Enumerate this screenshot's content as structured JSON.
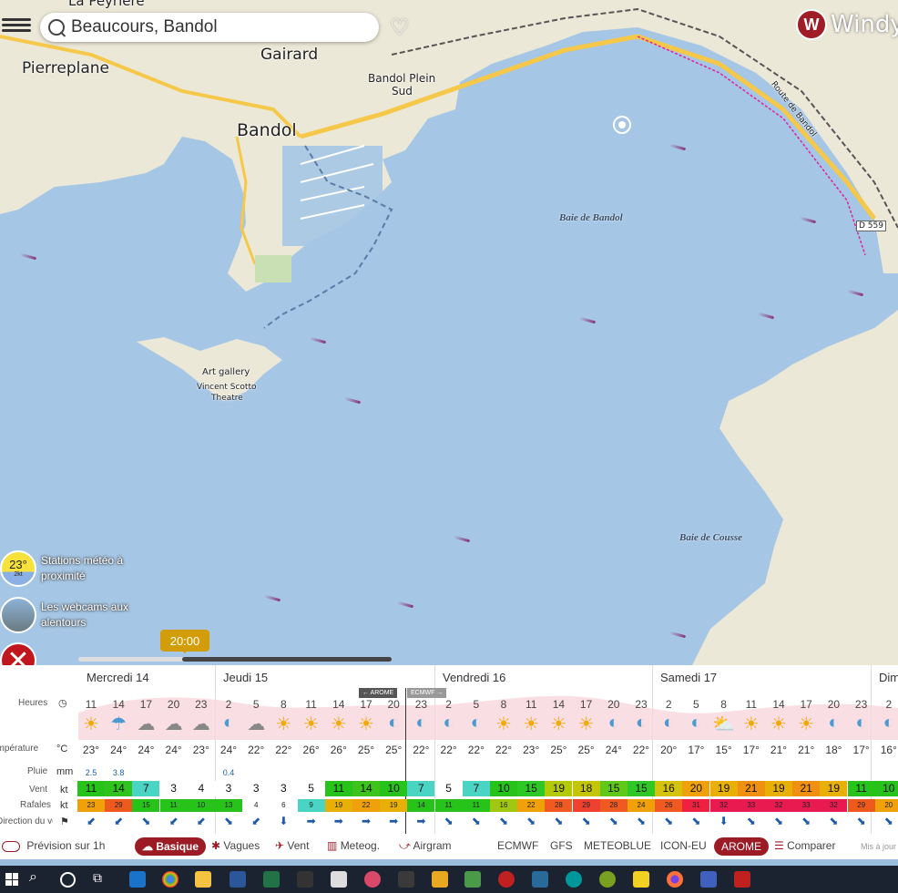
{
  "search": {
    "value": "Beaucours, Bandol",
    "placeholder": ""
  },
  "logo": {
    "text": "Windy"
  },
  "map": {
    "places": [
      {
        "name": "Pierreplane",
        "size": 17
      },
      {
        "name": "Gairard",
        "size": 17
      },
      {
        "name": "Bandol",
        "size": 19
      },
      {
        "name": "Bandol Plein",
        "size": 12
      },
      {
        "name": "Sud",
        "size": 12
      },
      {
        "name": "Art gallery",
        "size": 10
      },
      {
        "name": "Vincent Scotto",
        "size": 9
      },
      {
        "name": "Theatre",
        "size": 9
      },
      {
        "name": "Route de Bandol",
        "size": 9
      },
      {
        "name": "D 559",
        "size": 9
      },
      {
        "name": "La Peyrière",
        "size": 15
      }
    ],
    "sea_labels": [
      "Baie de Bandol",
      "Baie de Cousse"
    ]
  },
  "widgets": {
    "stations": {
      "temp": "23°",
      "wind": "2kt",
      "label_line1": "Stations météo à",
      "label_line2": "proximité"
    },
    "webcams": {
      "label_line1": "Les webcams aux",
      "label_line2": "alentours"
    }
  },
  "timeline": {
    "time": "20:00",
    "progress": 0.33
  },
  "forecast": {
    "days": [
      "Mercredi 14",
      "Jeudi 15",
      "Vendredi 16",
      "Samedi 17",
      "Dim"
    ],
    "row_labels": {
      "hours": "Heures",
      "temp": "Température",
      "temp_unit": "°C",
      "rain": "Pluie",
      "rain_unit": "mm",
      "wind": "Vent",
      "wind_unit": "kt",
      "gusts": "Rafales",
      "gusts_unit": "kt",
      "dir": "Direction du vent"
    },
    "model_tags": {
      "left": "← AROME",
      "right": "ECMWF →"
    },
    "hours": [
      "11",
      "14",
      "17",
      "20",
      "23",
      "2",
      "5",
      "8",
      "11",
      "14",
      "17",
      "20",
      "23",
      "2",
      "5",
      "8",
      "11",
      "14",
      "17",
      "20",
      "23",
      "2",
      "5",
      "8",
      "11",
      "14",
      "17",
      "20",
      "23",
      "2"
    ],
    "icons": [
      "sun-rain",
      "rain",
      "cloud",
      "moon-cloud",
      "moon-cloud",
      "moon",
      "moon-cloud",
      "sun",
      "sun",
      "sun",
      "sun",
      "moon",
      "moon",
      "moon",
      "moon",
      "sun",
      "sun",
      "sun",
      "sun",
      "moon",
      "moon",
      "moon",
      "moon",
      "sun-cloud",
      "sun",
      "sun",
      "sun",
      "moon",
      "moon",
      "moon"
    ],
    "temps": [
      "23°",
      "24°",
      "24°",
      "24°",
      "23°",
      "24°",
      "22°",
      "22°",
      "26°",
      "26°",
      "25°",
      "25°",
      "22°",
      "22°",
      "22°",
      "22°",
      "23°",
      "25°",
      "25°",
      "24°",
      "22°",
      "20°",
      "17°",
      "15°",
      "17°",
      "21°",
      "21°",
      "18°",
      "17°",
      "16°"
    ],
    "rain": [
      "2.5",
      "3.8",
      "",
      "",
      "",
      "0.4",
      "",
      "",
      "",
      "",
      "",
      "",
      "",
      "",
      "",
      "",
      "",
      "",
      "",
      "",
      "",
      "",
      "",
      "",
      "",
      "",
      "",
      "",
      "",
      ""
    ],
    "wind": [
      "11",
      "14",
      "7",
      "3",
      "4",
      "3",
      "3",
      "3",
      "5",
      "11",
      "14",
      "10",
      "7",
      "5",
      "7",
      "10",
      "15",
      "19",
      "18",
      "15",
      "15",
      "16",
      "20",
      "19",
      "21",
      "19",
      "21",
      "19",
      "11",
      "10"
    ],
    "gusts": [
      "23",
      "29",
      "15",
      "11",
      "10",
      "13",
      "4",
      "6",
      "9",
      "19",
      "22",
      "19",
      "14",
      "11",
      "11",
      "16",
      "22",
      "28",
      "29",
      "28",
      "24",
      "26",
      "31",
      "32",
      "33",
      "32",
      "33",
      "32",
      "29",
      "20"
    ],
    "wind_colors": [
      "#27c21a",
      "#30c21d",
      "#4ad4c3",
      "#ffffff",
      "#ffffff",
      "#ffffff",
      "#ffffff",
      "#ffffff",
      "#ffffff",
      "#27c21a",
      "#3ec21c",
      "#27c21a",
      "#4ad4c3",
      "#ffffff",
      "#4ad4c3",
      "#27c21a",
      "#2ec826",
      "#b3c807",
      "#c4c605",
      "#5fc81a",
      "#2ec826",
      "#d4c20c",
      "#f0a008",
      "#e8b007",
      "#f09010",
      "#e8b007",
      "#f09010",
      "#e8b007",
      "#27c21a",
      "#27c21a"
    ],
    "gust_colors": [
      "#f0a008",
      "#ee5a1d",
      "#27c21a",
      "#27c21a",
      "#27c21a",
      "#27c21a",
      "#ffffff",
      "#ffffff",
      "#4ad4c3",
      "#e8b007",
      "#f0a008",
      "#e8b007",
      "#27c21a",
      "#27c21a",
      "#27c21a",
      "#a0c810",
      "#f0a008",
      "#f05a22",
      "#f04030",
      "#f05a22",
      "#f0a008",
      "#f05a22",
      "#f02040",
      "#e81a50",
      "#e81a50",
      "#e81a50",
      "#e81a50",
      "#e81a50",
      "#ee5a1d",
      "#f0a008"
    ],
    "dirs": [
      "⬋",
      "⬋",
      "⬊",
      "⬋",
      "⬋",
      "⬊",
      "⬋",
      "⬇",
      "➡",
      "➡",
      "➡",
      "➡",
      "➡",
      "⬊",
      "⬊",
      "⬊",
      "⬊",
      "⬊",
      "⬊",
      "⬊",
      "⬊",
      "⬊",
      "⬊",
      "⬇",
      "⬊",
      "⬊",
      "⬊",
      "⬊",
      "⬊",
      "⬊"
    ]
  },
  "bottom_bar": {
    "forecast_1h": "Prévision sur 1h",
    "tabs": [
      "Basique",
      "Vagues",
      "Vent",
      "Meteog.",
      "Airgram"
    ],
    "models": [
      "ECMWF",
      "GFS",
      "METEOBLUE",
      "ICON-EU",
      "AROME"
    ],
    "compare": "Comparer",
    "updated": "Mis à jour"
  },
  "colors": {
    "accent": "#9c1c26",
    "timeline_bubble": "#d39d0a",
    "taskbar": "#1c2330"
  }
}
